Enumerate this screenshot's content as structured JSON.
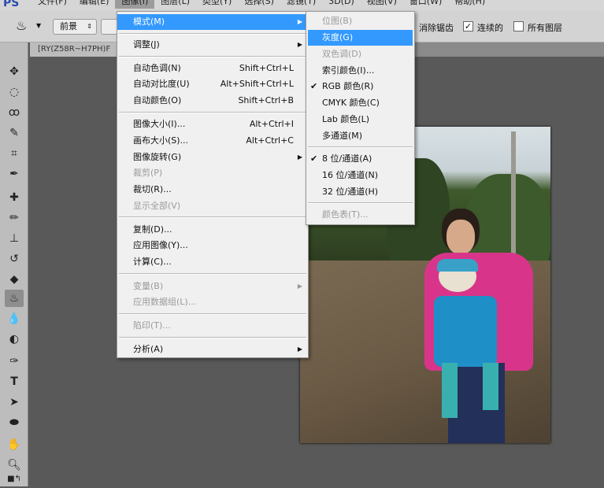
{
  "menubar": {
    "logo": "PS",
    "items": [
      "文件(F)",
      "编辑(E)",
      "图像(I)",
      "图层(L)",
      "类型(Y)",
      "选择(S)",
      "滤镜(T)",
      "3D(D)",
      "视图(V)",
      "窗口(W)",
      "帮助(H)"
    ]
  },
  "options": {
    "fill_source": "前景",
    "anti_alias": "消除锯齿",
    "contiguous": "连续的",
    "contiguous_checked": true,
    "all_layers": "所有图层",
    "all_layers_checked": false
  },
  "document_tab": "[RY(Z58R~H7PH)F",
  "image_menu": {
    "mode": "模式(M)",
    "adjust": "调整(J)",
    "auto": [
      {
        "label": "自动色调(N)",
        "shortcut": "Shift+Ctrl+L"
      },
      {
        "label": "自动对比度(U)",
        "shortcut": "Alt+Shift+Ctrl+L"
      },
      {
        "label": "自动颜色(O)",
        "shortcut": "Shift+Ctrl+B"
      }
    ],
    "size": [
      {
        "label": "图像大小(I)...",
        "shortcut": "Alt+Ctrl+I"
      },
      {
        "label": "画布大小(S)...",
        "shortcut": "Alt+Ctrl+C"
      },
      {
        "label": "图像旋转(G)"
      },
      {
        "label": "裁剪(P)"
      },
      {
        "label": "裁切(R)..."
      },
      {
        "label": "显示全部(V)"
      }
    ],
    "dup": [
      "复制(D)...",
      "应用图像(Y)...",
      "计算(C)..."
    ],
    "vars": [
      "变量(B)",
      "应用数据组(L)..."
    ],
    "trap": "陷印(T)...",
    "analysis": "分析(A)"
  },
  "mode_submenu": {
    "items": [
      "位图(B)",
      "灰度(G)",
      "双色调(D)",
      "索引颜色(I)...",
      "RGB 颜色(R)",
      "CMYK 颜色(C)",
      "Lab 颜色(L)",
      "多通道(M)"
    ],
    "depth": [
      "8 位/通道(A)",
      "16 位/通道(N)",
      "32 位/通道(H)"
    ],
    "color_table": "颜色表(T)...",
    "check": "✔"
  }
}
